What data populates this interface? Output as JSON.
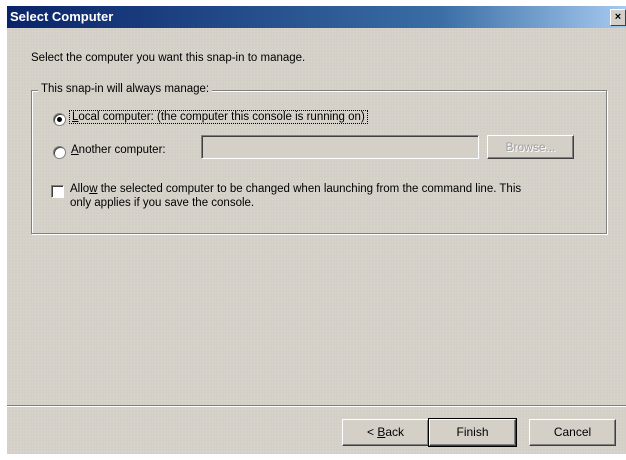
{
  "window": {
    "title": "Select Computer",
    "close_glyph": "×"
  },
  "instruction": "Select the computer you want this snap-in to manage.",
  "group": {
    "legend": "This snap-in will always manage:",
    "local": {
      "label_accel": "L",
      "label_rest": "ocal computer:  (the computer this console is running on)",
      "selected": true
    },
    "another": {
      "label_accel": "A",
      "label_rest": "nother computer:",
      "selected": false,
      "value": "",
      "browse_label": "Browse..."
    },
    "allow": {
      "line1_pre": "Allo",
      "line1_accel": "w",
      "line1_post": " the selected computer to be changed when launching from the command line.  This",
      "line2": "only applies if you save the console.",
      "checked": false
    }
  },
  "buttons": {
    "back_pre": "< ",
    "back_accel": "B",
    "back_post": "ack",
    "finish": "Finish",
    "cancel": "Cancel"
  }
}
